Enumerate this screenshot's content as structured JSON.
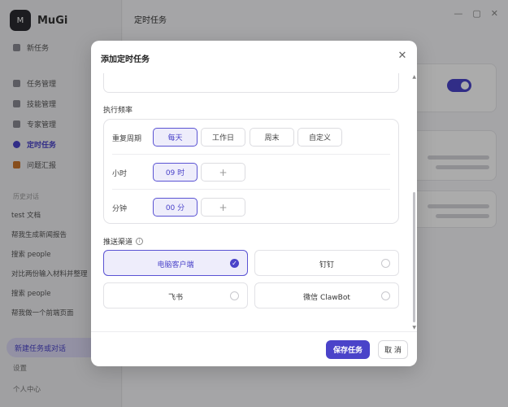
{
  "app": {
    "brand_logo": "M",
    "brand_name": "MuGi",
    "page_title": "定时任务",
    "window_controls": [
      "—",
      "▢",
      "✕"
    ]
  },
  "sidebar": {
    "top_item": "新任务",
    "nav": [
      "任务管理",
      "技能管理",
      "专家管理",
      "定时任务",
      "问题汇报"
    ],
    "section_label": "历史对话",
    "recent": [
      "test 文档",
      "帮我生成新闻报告",
      "搜索 people",
      "对比两份输入材料并整理",
      "搜索 people",
      "帮我做一个前端页面"
    ],
    "new_task_button": "新建任务或对话",
    "footer": [
      "设置",
      "个人中心"
    ]
  },
  "modal": {
    "title": "添加定时任务",
    "close_glyph": "✕",
    "frequency_label": "执行频率",
    "repeat": {
      "label": "重复周期",
      "options": [
        "每天",
        "工作日",
        "周末",
        "自定义"
      ],
      "selected": "每天"
    },
    "hour": {
      "label": "小时",
      "value": "09 时",
      "add": "+"
    },
    "minute": {
      "label": "分钟",
      "value": "00 分",
      "add": "+"
    },
    "channel_label": "推送渠道",
    "info_glyph": "i",
    "channels": [
      "电脑客户端",
      "钉钉",
      "飞书",
      "微信 ClawBot"
    ],
    "selected_channel": "电脑客户端",
    "check_glyph": "✓",
    "save_button": "保存任务",
    "cancel_button": "取 消"
  },
  "colors": {
    "accent": "#4a43c9",
    "accent_light": "#eeedfb",
    "overlay": "rgba(0,0,0,0.33)"
  }
}
